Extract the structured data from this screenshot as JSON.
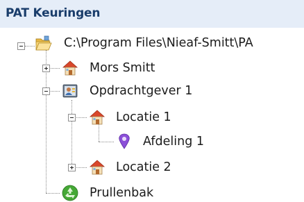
{
  "panel": {
    "title": "PAT Keuringen"
  },
  "tree": {
    "root": {
      "label": "C:\\Program Files\\Nieaf-Smitt\\PA",
      "icon": "open-folder-icon"
    },
    "mors_smitt": {
      "label": "Mors Smitt",
      "icon": "house-icon"
    },
    "opdrachtgever": {
      "label": "Opdrachtgever 1",
      "icon": "client-card-icon"
    },
    "locatie1": {
      "label": "Locatie 1",
      "icon": "house-icon"
    },
    "afdeling1": {
      "label": "Afdeling 1",
      "icon": "location-pin-icon"
    },
    "locatie2": {
      "label": "Locatie 2",
      "icon": "house-icon"
    },
    "prullenbak": {
      "label": "Prullenbak",
      "icon": "recycle-icon"
    }
  },
  "colors": {
    "header_bg": "#e5edf8",
    "header_text": "#1a3d6b",
    "pin": "#8b4fd8",
    "house_roof": "#d9472b",
    "recycle": "#45a836"
  }
}
